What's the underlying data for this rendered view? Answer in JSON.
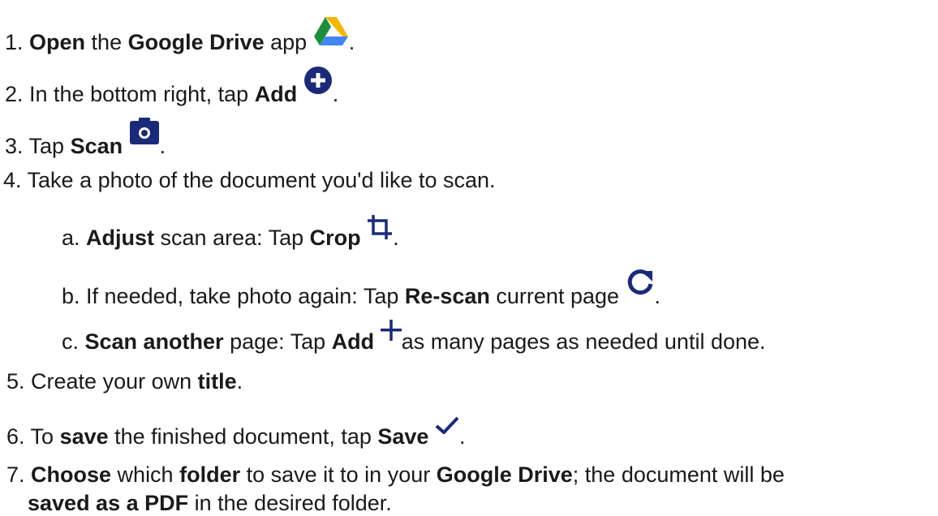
{
  "colors": {
    "text": "#1a1a1a",
    "icon_navy": "#1b2a78",
    "drive_yellow": "#f6b704",
    "drive_green": "#1e8e3e",
    "drive_blue": "#4285f4"
  },
  "steps": [
    {
      "num": "1.",
      "parts": [
        {
          "t": "Open",
          "b": true
        },
        {
          "t": " the "
        },
        {
          "t": "Google Drive",
          "b": true
        },
        {
          "t": " app "
        },
        {
          "icon": "google-drive-icon"
        },
        {
          "t": "."
        }
      ]
    },
    {
      "num": "2.",
      "parts": [
        {
          "t": "In the bottom right, tap "
        },
        {
          "t": "Add",
          "b": true
        },
        {
          "t": " "
        },
        {
          "icon": "add-circle-icon"
        },
        {
          "t": "."
        }
      ]
    },
    {
      "num": "3.",
      "parts": [
        {
          "t": "Tap "
        },
        {
          "t": "Scan",
          "b": true
        },
        {
          "t": " "
        },
        {
          "icon": "camera-icon"
        },
        {
          "t": "."
        }
      ]
    },
    {
      "num": "4.",
      "parts": [
        {
          "t": "Take a photo of the document you'd like to scan."
        }
      ]
    },
    {
      "num": "a.",
      "parts": [
        {
          "t": "Adjust",
          "b": true
        },
        {
          "t": " scan area: Tap "
        },
        {
          "t": "Crop",
          "b": true
        },
        {
          "t": " "
        },
        {
          "icon": "crop-icon"
        },
        {
          "t": "."
        }
      ]
    },
    {
      "num": "b.",
      "parts": [
        {
          "t": "If needed, take photo again: Tap "
        },
        {
          "t": "Re-scan",
          "b": true
        },
        {
          "t": " current page "
        },
        {
          "icon": "refresh-icon"
        },
        {
          "t": "."
        }
      ]
    },
    {
      "num": "c.",
      "parts": [
        {
          "t": "Scan another",
          "b": true
        },
        {
          "t": " page: Tap "
        },
        {
          "t": "Add",
          "b": true
        },
        {
          "t": " "
        },
        {
          "icon": "plus-icon"
        },
        {
          "t": "as many pages as needed until done."
        }
      ]
    },
    {
      "num": "5.",
      "parts": [
        {
          "t": "Create your own "
        },
        {
          "t": "title",
          "b": true
        },
        {
          "t": "."
        }
      ]
    },
    {
      "num": "6.",
      "parts": [
        {
          "t": "To "
        },
        {
          "t": "save",
          "b": true
        },
        {
          "t": " the finished document, tap "
        },
        {
          "t": "Save",
          "b": true
        },
        {
          "t": " "
        },
        {
          "icon": "checkmark-icon"
        },
        {
          "t": "."
        }
      ]
    },
    {
      "num": "7.",
      "parts": [
        {
          "t": "Choose",
          "b": true
        },
        {
          "t": " which "
        },
        {
          "t": "folder",
          "b": true
        },
        {
          "t": " to save it to in your "
        },
        {
          "t": "Google Drive",
          "b": true
        },
        {
          "t": "; the document will be"
        }
      ]
    },
    {
      "num": "",
      "parts": [
        {
          "t": "saved as a PDF",
          "b": true
        },
        {
          "t": " in the desired folder."
        }
      ]
    }
  ]
}
